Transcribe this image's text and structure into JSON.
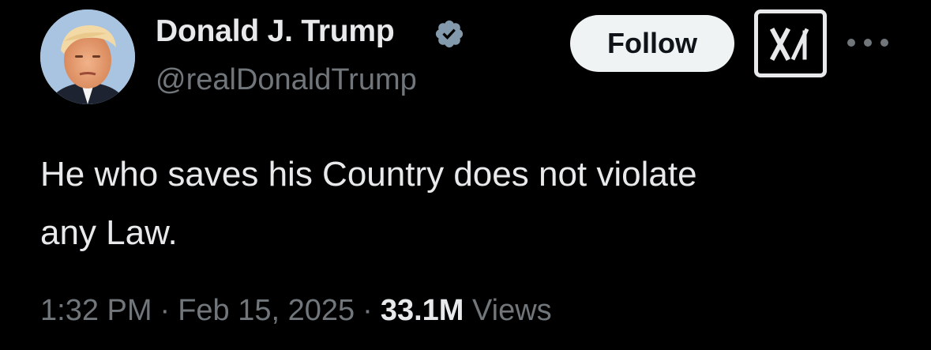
{
  "author": {
    "display_name": "Donald J. Trump",
    "handle": "@realDonaldTrump",
    "verified": true,
    "verified_badge_color": "#829aab"
  },
  "actions": {
    "follow_label": "Follow",
    "grok_icon": "grok-icon",
    "more_icon": "more-icon"
  },
  "tweet": {
    "text_lines": [
      "He who saves his Country does not violate",
      "any Law."
    ]
  },
  "meta": {
    "time": "1:32 PM",
    "separator": "·",
    "date": "Feb 15, 2025",
    "views_count": "33.1M",
    "views_label": "Views"
  },
  "colors": {
    "background": "#000000",
    "primary_text": "#e7e9ea",
    "secondary_text": "#71767b",
    "follow_button_bg": "#eff3f4",
    "follow_button_text": "#0f1419"
  }
}
